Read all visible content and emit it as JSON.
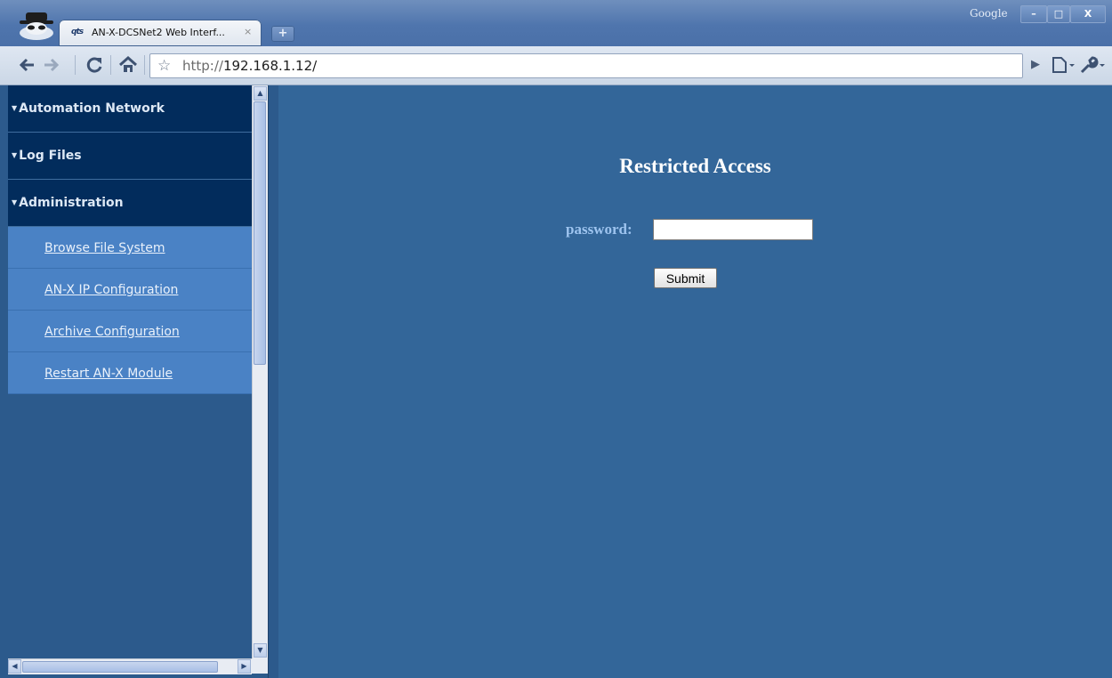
{
  "browser": {
    "tab_title": "AN-X-DCSNet2 Web Interf...",
    "tab_favicon_text": "qts",
    "tab_close": "×",
    "new_tab": "+",
    "brand_label": "Google",
    "window_buttons": {
      "minimize": "–",
      "maximize": "□",
      "close": "X"
    },
    "url_scheme": "http://",
    "url_host": "192.168.1.12/",
    "icons": [
      "incognito-icon",
      "back-icon",
      "forward-icon",
      "reload-icon",
      "home-icon",
      "star-icon",
      "play-icon",
      "page-menu-icon",
      "wrench-menu-icon"
    ]
  },
  "sidebar": {
    "sections": [
      {
        "label": "Automation Network"
      },
      {
        "label": "Log Files"
      },
      {
        "label": "Administration"
      }
    ],
    "admin_items": [
      {
        "label": "Browse File System"
      },
      {
        "label": "AN-X IP Configuration"
      },
      {
        "label": "Archive Configuration"
      },
      {
        "label": "Restart AN-X Module"
      }
    ]
  },
  "main": {
    "heading": "Restricted Access",
    "password_label": "password:",
    "password_value": "",
    "submit_label": "Submit"
  },
  "colors": {
    "content_bg": "#336699",
    "nav_header_bg": "#022c5c",
    "nav_item_bg": "#4a82c5",
    "label_accent": "#9ec4ef"
  }
}
